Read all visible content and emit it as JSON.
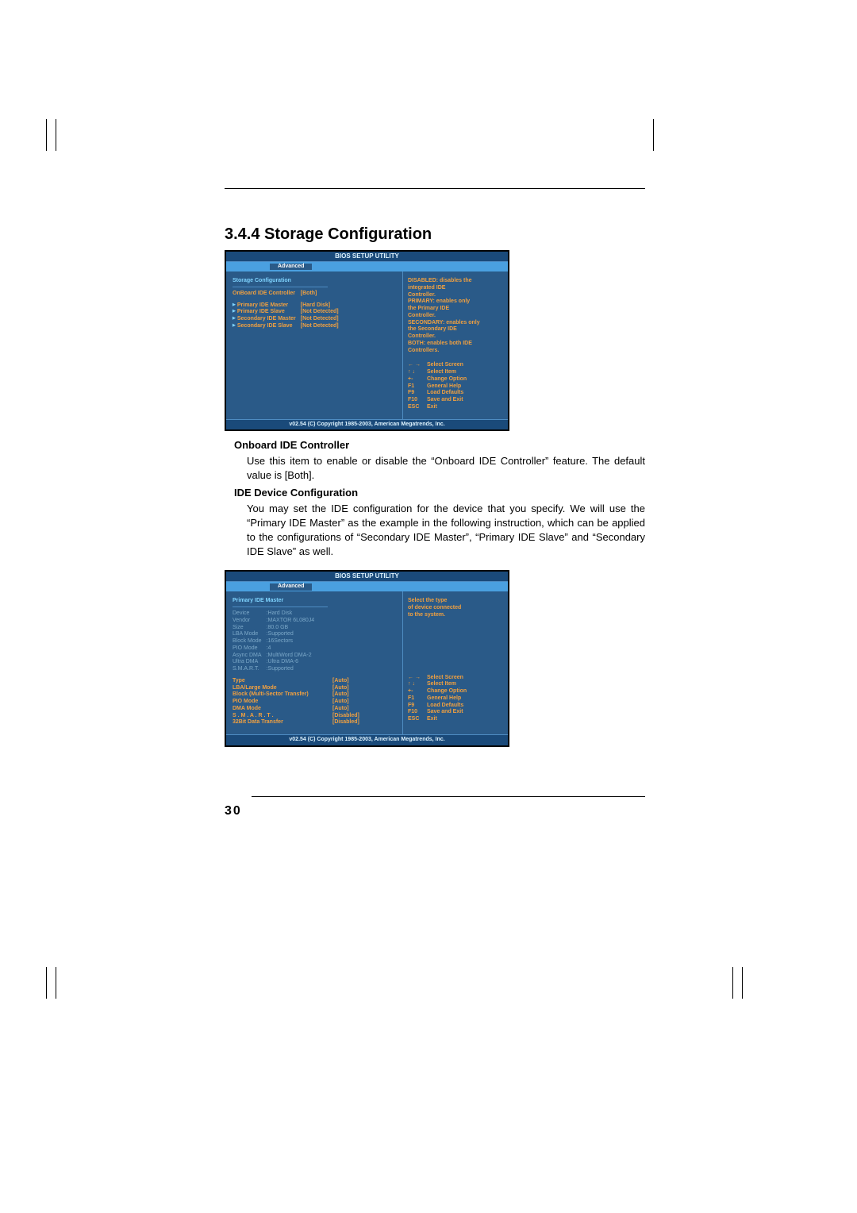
{
  "section": {
    "number": "3.4.4",
    "title": "Storage Configuration"
  },
  "page_number": "30",
  "bios_common": {
    "title": "BIOS SETUP UTILITY",
    "tab": "Advanced",
    "footer": "v02.54 (C) Copyright 1985-2003, American Megatrends, Inc.",
    "nav": {
      "select_screen": "Select Screen",
      "select_item": "Select Item",
      "change_option": "Change Option",
      "general_help": "General Help",
      "load_defaults": "Load Defaults",
      "save_exit": "Save and Exit",
      "exit": "Exit",
      "k_lr": "← →",
      "k_ud": "↑ ↓",
      "k_pm": "+-",
      "k_f1": "F1",
      "k_f9": "F9",
      "k_f10": "F10",
      "k_esc": "ESC"
    }
  },
  "bios1": {
    "heading": "Storage Configuration",
    "row_controller_label": "OnBoard IDE Controller",
    "row_controller_value": "[Both]",
    "rows": [
      {
        "label": "Primary IDE Master",
        "value": "[Hard Disk]"
      },
      {
        "label": "Primary IDE Slave",
        "value": "[Not Detected]"
      },
      {
        "label": "Secondary IDE Master",
        "value": "[Not Detected]"
      },
      {
        "label": "Secondary IDE Slave",
        "value": "[Not Detected]"
      }
    ],
    "help": {
      "l1": "DISABLED: disables the",
      "l2": "integrated IDE",
      "l3": "Controller.",
      "l4": "PRIMARY: enables only",
      "l5": "the Primary IDE",
      "l6": "Controller.",
      "l7": "SECONDARY: enables only",
      "l8": "the Secondary IDE",
      "l9": "Controller.",
      "l10": "BOTH: enables both IDE",
      "l11": "Controllers."
    }
  },
  "bios2": {
    "heading": "Primary IDE Master",
    "info": [
      {
        "k": "Device",
        "v": ":Hard Disk"
      },
      {
        "k": "Vendor",
        "v": ":MAXTOR 6L080J4"
      },
      {
        "k": "Size",
        "v": ":80.0 GB"
      },
      {
        "k": "LBA Mode",
        "v": ":Supported"
      },
      {
        "k": "Block Mode",
        "v": ":16Sectors"
      },
      {
        "k": "PIO Mode",
        "v": ":4"
      },
      {
        "k": "Async DMA",
        "v": ":MultiWord DMA-2"
      },
      {
        "k": "Ultra DMA",
        "v": ":Ultra DMA-6"
      },
      {
        "k": "S.M.A.R.T.",
        "v": ":Supported"
      }
    ],
    "type_label": "Type",
    "type_value": "[Auto]",
    "opts": [
      {
        "label": "LBA/Large Mode",
        "value": "[Auto]"
      },
      {
        "label": "Block (Multi-Sector Transfer)",
        "value": "[Auto]"
      },
      {
        "label": "PIO Mode",
        "value": "[Auto]"
      },
      {
        "label": "DMA Mode",
        "value": "[Auto]"
      },
      {
        "label": "S . M . A . R . T .",
        "value": "[Disabled]"
      },
      {
        "label": "32Bit Data Transfer",
        "value": "[Disabled]"
      }
    ],
    "help": {
      "l1": "Select the type",
      "l2": "of device connected",
      "l3": "to the system."
    }
  },
  "descriptions": {
    "h1": "Onboard IDE Controller",
    "p1": "Use this item to enable or disable the “Onboard IDE Controller” feature. The default value is [Both].",
    "h2": "IDE Device Configuration",
    "p2": "You may set the IDE configuration for the device that you specify. We will use the “Primary IDE Master” as the example in the following instruction, which can be applied to the configurations of “Secondary IDE Master”, “Primary IDE Slave” and “Secondary IDE Slave” as well."
  }
}
